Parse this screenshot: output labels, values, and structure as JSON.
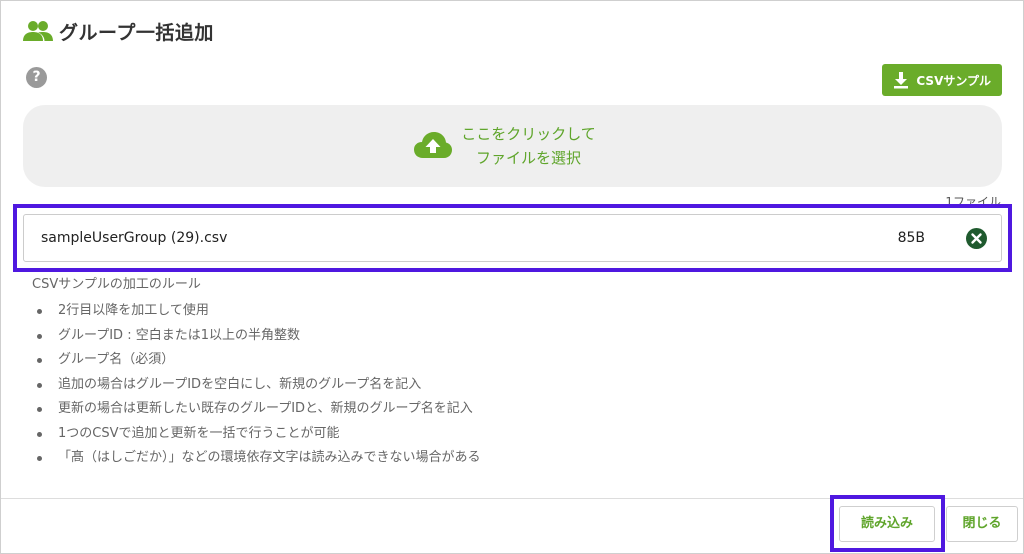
{
  "dialog": {
    "title": "グループ一括追加",
    "title_icon": "group-icon",
    "help_icon": "help-icon",
    "help_glyph": "?"
  },
  "toolbar": {
    "csv_sample_label": "CSVサンプル",
    "csv_sample_icon": "download-icon"
  },
  "dropzone": {
    "line1": "ここをクリックして",
    "line2": "ファイルを選択",
    "icon": "cloud-upload-icon"
  },
  "file_list": {
    "count_label": "1ファイル",
    "files": [
      {
        "name": "sampleUserGroup (29).csv",
        "size": "85B",
        "remove_icon": "remove-circle-icon"
      }
    ]
  },
  "rules": {
    "title": "CSVサンプルの加工のルール",
    "items": [
      "2行目以降を加工して使用",
      "グループID : 空白または1以上の半角整数",
      "グループ名（必須）",
      "追加の場合はグループIDを空白にし、新規のグループ名を記入",
      "更新の場合は更新したい既存のグループIDと、新規のグループ名を記入",
      "1つのCSVで追加と更新を一括で行うことが可能",
      "「髙（はしごだか）」などの環境依存文字は読み込みできない場合がある"
    ]
  },
  "footer": {
    "read_label": "読み込み",
    "close_label": "閉じる"
  },
  "colors": {
    "accent_green": "#6aac2a",
    "text_green": "#5fa52b",
    "highlight_purple": "#4f18e0",
    "remove_icon_dark_green": "#1f5a2e"
  }
}
